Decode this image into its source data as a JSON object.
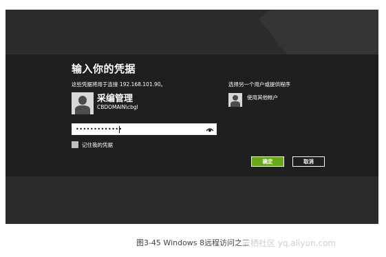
{
  "dialog": {
    "title": "输入你的凭据",
    "subtitle": "这些凭据将用于连接 192.168.101.90。",
    "user": {
      "name": "采编管理",
      "account": "CBDOMAIN\\cbgl"
    },
    "password": {
      "masked_value": "•••••••••••••",
      "reveal_icon": "eye-icon"
    },
    "remember_label": "记住我的凭据",
    "other_section": {
      "title": "选择另一个用户或提供程序",
      "option_label": "使用其他帐户"
    },
    "buttons": {
      "ok": "确定",
      "cancel": "取消"
    }
  },
  "caption": "图3-45   Windows 8远程访问之三",
  "watermark": "云栖社区 yq.aliyun.com",
  "colors": {
    "background": "#2c2c2c",
    "band": "#1f1f1f",
    "ok_button": "#67a816"
  }
}
